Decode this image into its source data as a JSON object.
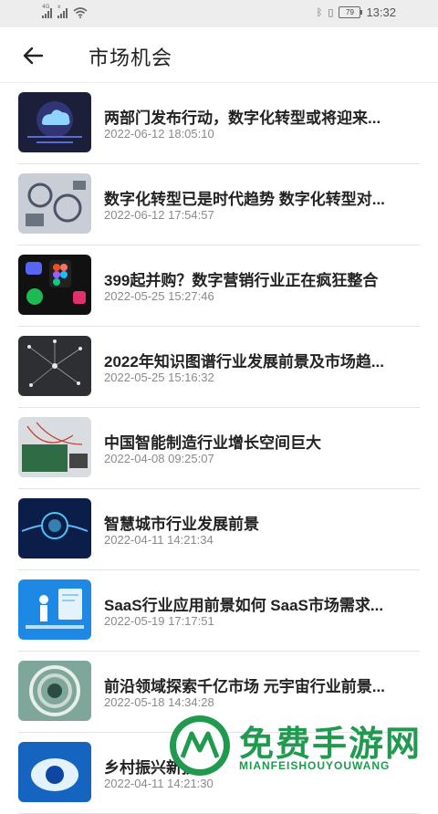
{
  "status_bar": {
    "signal1_tag": "4G",
    "signal2_tag": "x",
    "battery": "79",
    "time": "13:32",
    "icons": [
      "signal-icon",
      "signal-icon",
      "wifi-icon",
      "bluetooth-icon",
      "vibrate-icon",
      "battery-icon"
    ]
  },
  "header": {
    "back_icon": "arrow-left-icon",
    "title": "市场机会"
  },
  "articles": [
    {
      "title": "两部门发布行动，数字化转型或将迎来...",
      "date": "2022-06-12 18:05:10"
    },
    {
      "title": "数字化转型已是时代趋势 数字化转型对...",
      "date": "2022-06-12 17:54:57"
    },
    {
      "title": "399起并购？数字营销行业正在疯狂整合",
      "date": "2022-05-25 15:27:46"
    },
    {
      "title": "2022年知识图谱行业发展前景及市场趋...",
      "date": "2022-05-25 15:16:32"
    },
    {
      "title": "中国智能制造行业增长空间巨大",
      "date": "2022-04-08 09:25:07"
    },
    {
      "title": "智慧城市行业发展前景",
      "date": "2022-04-11 14:21:34"
    },
    {
      "title": "SaaS行业应用前景如何 SaaS市场需求...",
      "date": "2022-05-19 17:17:51"
    },
    {
      "title": "前沿领域探索千亿市场 元宇宙行业前景...",
      "date": "2022-05-18 14:34:28"
    },
    {
      "title": "乡村振兴新技术",
      "date": "2022-04-11 14:21:30"
    }
  ],
  "watermark": {
    "text": "免费手游网",
    "sub": "MIANFEISHOUYOUWANG",
    "color": "#1f9a4e"
  }
}
